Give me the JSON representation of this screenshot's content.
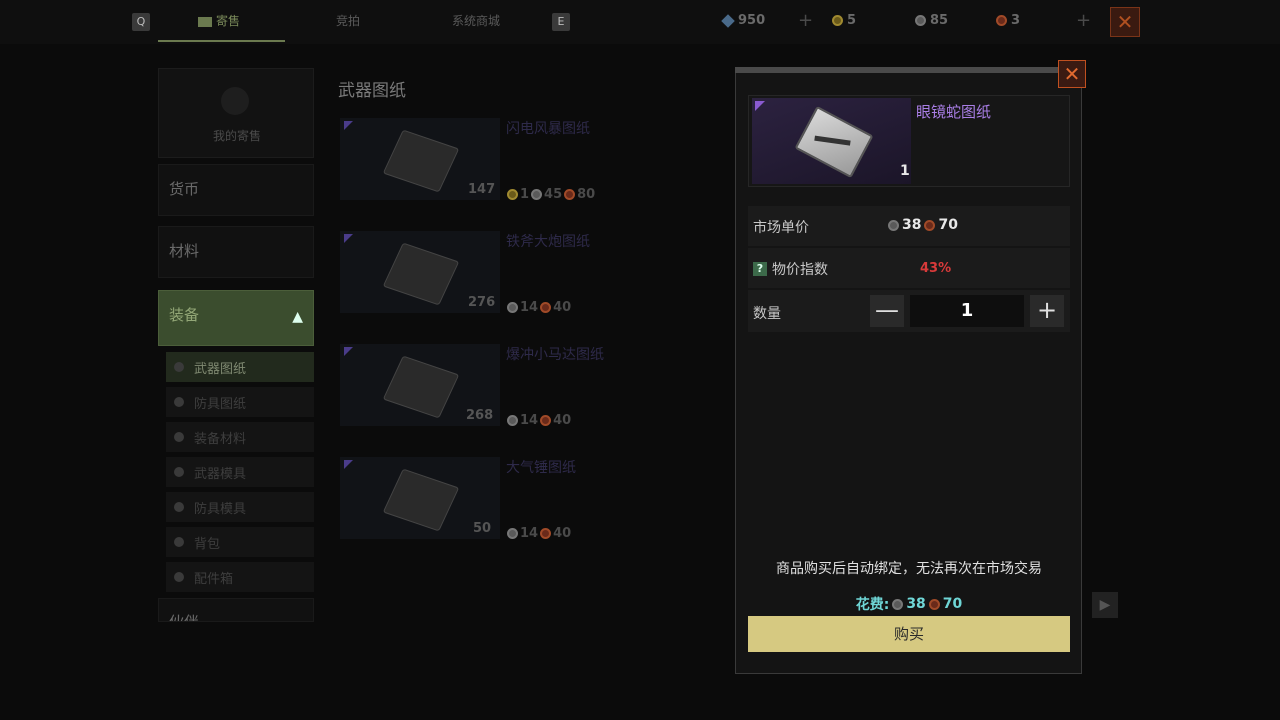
{
  "topbar": {
    "key_left": "Q",
    "key_right": "E",
    "tabs": [
      {
        "label": "寄售"
      },
      {
        "label": "竞拍"
      },
      {
        "label": "系统商城"
      }
    ],
    "currencies": [
      {
        "icon": "diamond-icon",
        "value": "950"
      },
      {
        "icon": "gold-gear-icon",
        "value": "5"
      },
      {
        "icon": "gray-gear-icon",
        "value": "85"
      },
      {
        "icon": "red-gear-icon",
        "value": "3"
      }
    ]
  },
  "sidebar": {
    "my_sale": "我的寄售",
    "categories": [
      {
        "label": "货币"
      },
      {
        "label": "材料"
      },
      {
        "label": "装备"
      },
      {
        "label": "伙伴"
      }
    ],
    "subitems": [
      {
        "label": "武器图纸"
      },
      {
        "label": "防具图纸"
      },
      {
        "label": "装备材料"
      },
      {
        "label": "武器模具"
      },
      {
        "label": "防具模具"
      },
      {
        "label": "背包"
      },
      {
        "label": "配件箱"
      }
    ]
  },
  "list": {
    "title": "武器图纸",
    "items": [
      {
        "name": "闪电风暴图纸",
        "count": "147",
        "price": [
          "1",
          "45",
          "80"
        ]
      },
      {
        "name": "铁斧大炮图纸",
        "count": "276",
        "price": [
          "14",
          "40"
        ]
      },
      {
        "name": "爆冲小马达图纸",
        "count": "268",
        "price": [
          "14",
          "40"
        ]
      },
      {
        "name": "大气锤图纸",
        "count": "50",
        "price": [
          "14",
          "40"
        ]
      }
    ]
  },
  "modal": {
    "item_name": "眼镜蛇图纸",
    "item_qty": "1",
    "market_price_label": "市场单价",
    "market_price": [
      "38",
      "70"
    ],
    "index_label": "物价指数",
    "index_q": "?",
    "index_value": "43%",
    "qty_label": "数量",
    "qty_minus": "—",
    "qty_value": "1",
    "qty_plus": "+",
    "notice": "商品购买后自动绑定，无法再次在市场交易",
    "cost_label": "花费:",
    "cost": [
      "38",
      "70"
    ],
    "buy_label": "购买",
    "close": "✕"
  },
  "colors": {
    "accent_green": "#3b4d2e",
    "buy_yellow": "#d6c981",
    "rare_purple": "#a97ee6",
    "warning_red": "#d83a3a",
    "cost_cyan": "#6fd6d6"
  }
}
